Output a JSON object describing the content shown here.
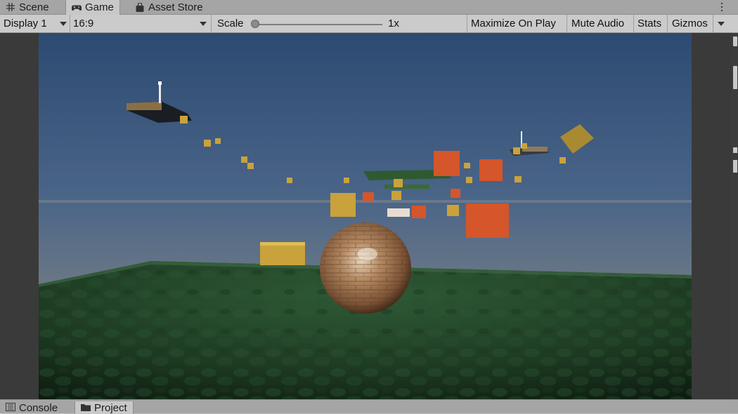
{
  "tabs": [
    {
      "label": "Scene",
      "icon": "grid-icon"
    },
    {
      "label": "Game",
      "icon": "gamepad-icon"
    },
    {
      "label": "Asset Store",
      "icon": "bag-icon"
    }
  ],
  "toolbar": {
    "display": "Display 1",
    "aspect": "16:9",
    "scale_label": "Scale",
    "scale_value": "1x",
    "maximize_label": "Maximize On Play",
    "mute_label": "Mute Audio",
    "stats_label": "Stats",
    "gizmos_label": "Gizmos"
  },
  "bottom_tabs": [
    {
      "label": "Console",
      "icon": "console-icon"
    },
    {
      "label": "Project",
      "icon": "folder-icon"
    }
  ],
  "colors": {
    "sky_top": "#2d4a72",
    "sky_horizon": "#6f7a86",
    "ground": "#1f3a24",
    "gold_block": "#c9a23c",
    "orange_block": "#d4562a",
    "ball": "#9a7250"
  }
}
